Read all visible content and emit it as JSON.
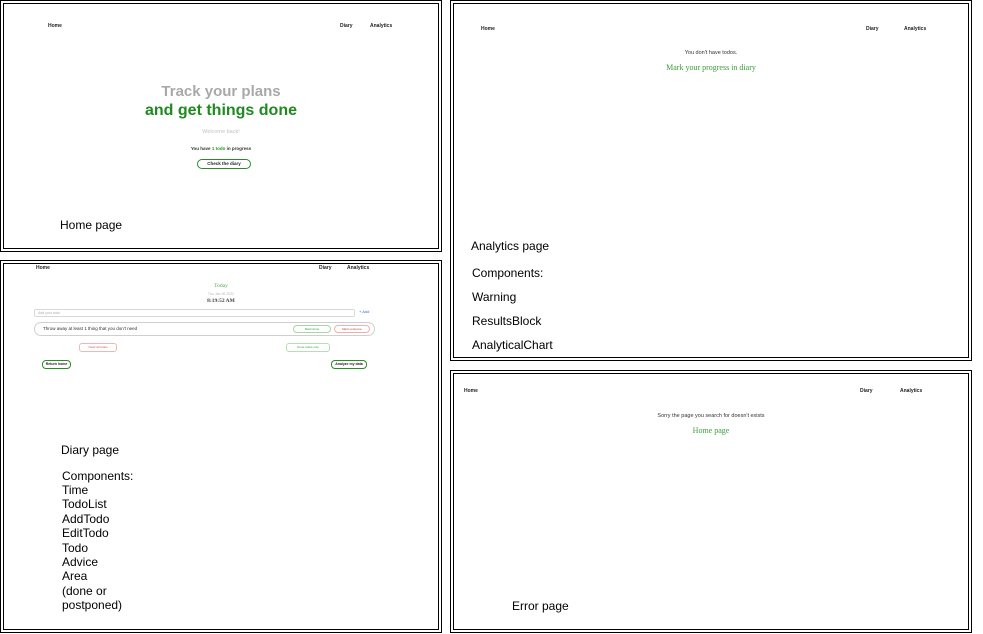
{
  "nav": {
    "home": "Home",
    "diary": "Diary",
    "analytics": "Analytics"
  },
  "home": {
    "hero_line1": "Track your plans",
    "hero_line2": "and get things done",
    "welcome": "Welcome back!",
    "progress_prefix": "You have ",
    "progress_count": "1 todo",
    "progress_suffix": " in progress",
    "button": "Check the diary",
    "caption": "Home page"
  },
  "analytics": {
    "warning": "You don't have todos.",
    "link": "Mark your progress in diary",
    "caption": "Analytics page",
    "components_title": "Components:",
    "components": [
      "Warning",
      "ResultsBlock",
      "AnalyticalChart"
    ]
  },
  "diary": {
    "today": "Today",
    "date": "Thu Jan 06 2022",
    "time": "8:19:52 AM",
    "input_placeholder": "Add your todo",
    "add_button": "+ Add",
    "todo_text": "Throw away at least 1 thing that you don't need",
    "done_button": "Mark done",
    "postpone_button": "Mark postpone",
    "postponed_area": "Clear all todos",
    "done_area": "Done todos only",
    "return_button": "Return home",
    "analyze_button": "Analyze my data",
    "caption": "Diary page",
    "components_title": "Components:",
    "components": [
      "Time",
      "TodoList",
      "AddTodo",
      "EditTodo",
      "Todo",
      "Advice",
      "Area",
      "(done or",
      "postponed)"
    ]
  },
  "error": {
    "message": "Sorry the page you search for doesn't exists",
    "link": "Home page",
    "caption": "Error page"
  }
}
